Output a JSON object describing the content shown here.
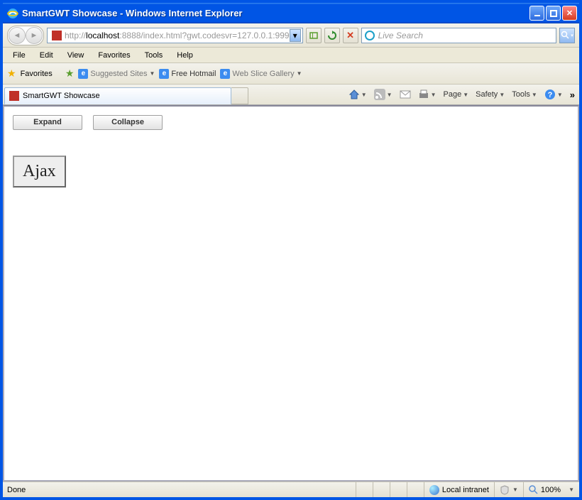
{
  "titlebar": {
    "title": "SmartGWT Showcase - Windows Internet Explorer"
  },
  "nav": {
    "url_prefix": "http://",
    "url_host": "localhost",
    "url_suffix": ":8888/index.html?gwt.codesvr=127.0.0.1:999",
    "search_placeholder": "Live Search"
  },
  "menu": {
    "items": [
      "File",
      "Edit",
      "View",
      "Favorites",
      "Tools",
      "Help"
    ]
  },
  "favbar": {
    "label": "Favorites",
    "links": [
      "Suggested Sites",
      "Free Hotmail",
      "Web Slice Gallery"
    ]
  },
  "tab": {
    "label": "SmartGWT Showcase"
  },
  "cmd": {
    "items": [
      "Page",
      "Safety",
      "Tools"
    ]
  },
  "content": {
    "expand": "Expand",
    "collapse": "Collapse",
    "ajax": "Ajax"
  },
  "status": {
    "left": "Done",
    "zone": "Local intranet",
    "zoom": "100%"
  }
}
